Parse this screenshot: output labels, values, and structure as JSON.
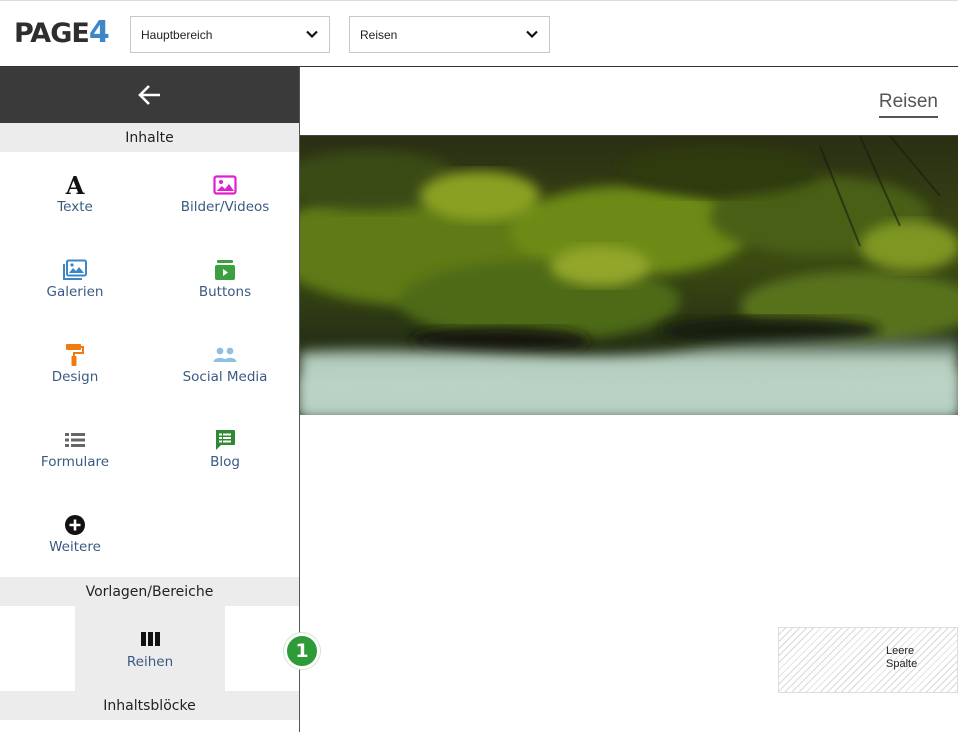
{
  "app": {
    "logo_text": "PAGE",
    "logo_number": "4"
  },
  "toolbar": {
    "area_select": {
      "value": "Hauptbereich"
    },
    "page_select": {
      "value": "Reisen"
    }
  },
  "sidebar": {
    "back_icon": "arrow-left-icon",
    "sections": {
      "content": "Inhalte",
      "templates": "Vorlagen/Bereiche",
      "blocks": "Inhaltsblöcke"
    },
    "items": [
      {
        "label": "Texte",
        "icon": "text-icon",
        "color": "#111111"
      },
      {
        "label": "Bilder/Videos",
        "icon": "image-icon",
        "color": "#e020d0"
      },
      {
        "label": "Galerien",
        "icon": "gallery-icon",
        "color": "#3a86c8"
      },
      {
        "label": "Buttons",
        "icon": "button-icon",
        "color": "#3aa040"
      },
      {
        "label": "Design",
        "icon": "paint-roller-icon",
        "color": "#f07a10"
      },
      {
        "label": "Social Media",
        "icon": "users-icon",
        "color": "#8fc0e0"
      },
      {
        "label": "Formulare",
        "icon": "list-icon",
        "color": "#666666"
      },
      {
        "label": "Blog",
        "icon": "blog-icon",
        "color": "#2e8a30"
      },
      {
        "label": "Weitere",
        "icon": "plus-circle-icon",
        "color": "#111111"
      }
    ],
    "templates": [
      {
        "label": "Reihen",
        "icon": "columns-icon"
      }
    ]
  },
  "canvas": {
    "nav_link": "Reisen",
    "badge": "1",
    "empty_column": {
      "line1": "Leere",
      "line2": "Spalte"
    }
  }
}
